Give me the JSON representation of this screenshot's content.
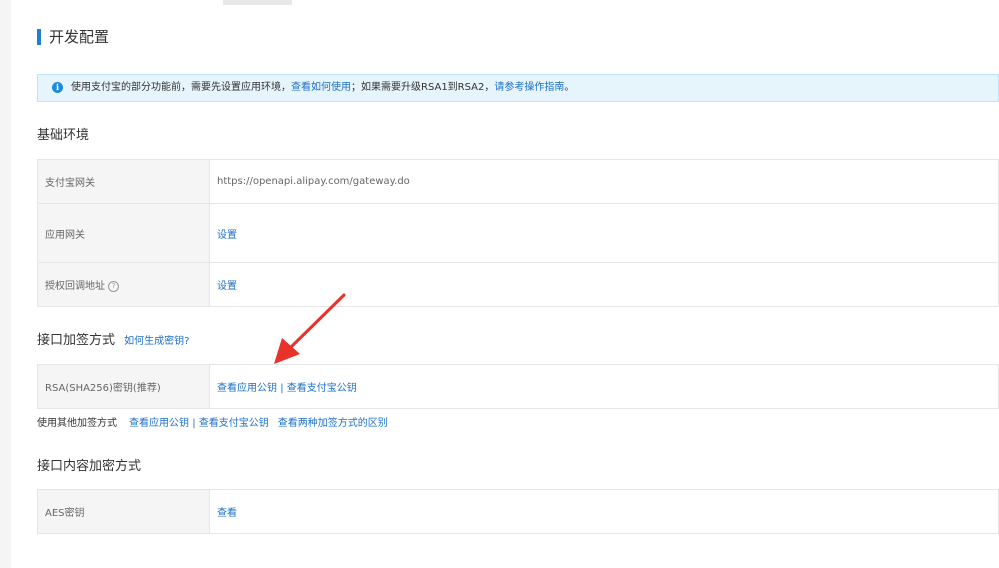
{
  "page": {
    "title": "开发配置"
  },
  "notice": {
    "text_before": "使用支付宝的部分功能前，需要先设置应用环境，",
    "link1": "查看如何使用",
    "text_middle": "；如果需要升级RSA1到RSA2，",
    "link2": "请参考操作指南",
    "text_after": "。"
  },
  "basic_env": {
    "title": "基础环境",
    "rows": [
      {
        "label": "支付宝网关",
        "value": "https://openapi.alipay.com/gateway.do"
      },
      {
        "label": "应用网关",
        "value": "设置"
      },
      {
        "label": "授权回调地址",
        "value": "设置"
      }
    ]
  },
  "signing": {
    "title": "接口加签方式",
    "help_link": "如何生成密钥?",
    "row": {
      "label": "RSA(SHA256)密钥(推荐)",
      "link1": "查看应用公钥",
      "separator": "|",
      "link2": "查看支付宝公钥"
    },
    "other": {
      "label": "使用其他加签方式",
      "link1": "查看应用公钥",
      "separator": "|",
      "link2": "查看支付宝公钥",
      "link3": "查看两种加签方式的区别"
    }
  },
  "encryption": {
    "title": "接口内容加密方式",
    "row": {
      "label": "AES密钥",
      "value": "查看"
    }
  },
  "colors": {
    "accent": "#1e7ed2",
    "link": "#1e6fc9",
    "annotation_arrow": "#e8322b"
  }
}
